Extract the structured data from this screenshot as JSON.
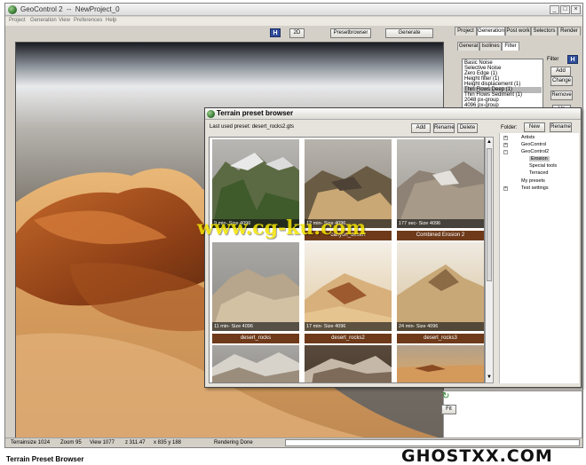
{
  "window": {
    "title": "GeoControl 2  --  NewProject_0",
    "btn_min": "_",
    "btn_max": "□",
    "btn_close": "×"
  },
  "menu": [
    "Project",
    "Generation",
    "View",
    "Preferences",
    "Help"
  ],
  "toolbar": {
    "h_button": "H",
    "view_2d": "2D",
    "preset_browser": "Presetbrowser",
    "generate": "Generate"
  },
  "right_panel": {
    "tabs": [
      "Project",
      "Generation",
      "Post work",
      "Selectors",
      "Render"
    ],
    "subtabs": [
      "General",
      "Isolines",
      "Filter"
    ],
    "filter_label": "Filter",
    "h_button": "H",
    "filters": [
      "Basic Noise",
      "Selective Noise",
      "Zero Edge  (1)",
      "Height filter  (1)",
      "Height displacement  (1)",
      "Thin Flows Deep  (1)",
      "Thin Flows Sediment  (1)",
      "2048 px-group",
      "4096 px-group"
    ],
    "selected_filter_index": 5,
    "buttons": {
      "add": "Add",
      "change": "Change",
      "remove": "Remove",
      "up": "Up"
    },
    "fit": "Fit"
  },
  "dialog": {
    "title": "Terrain preset browser",
    "last_used": "Last used preset: desert_rocks2.gts",
    "buttons": {
      "add": "Add",
      "rename": "Rename",
      "delete": "Delete"
    },
    "folder_label": "Folder:",
    "folder_buttons": {
      "new": "New",
      "rename": "Rename"
    },
    "presets": [
      {
        "caption": "9 min- Size 4096",
        "name": ""
      },
      {
        "caption": "12 min- Size 4096",
        "name": "canyon_desert"
      },
      {
        "caption": "177 sec- Size 4096",
        "name": "Combined Erosion 2"
      },
      {
        "caption": "11 min- Size 4096",
        "name": "desert_rocks"
      },
      {
        "caption": "17 min- Size 4096",
        "name": "desert_rocks2"
      },
      {
        "caption": "24 min- Size 4096",
        "name": "desert_rocks3"
      },
      {
        "caption": "",
        "name": ""
      },
      {
        "caption": "",
        "name": ""
      },
      {
        "caption": "",
        "name": ""
      }
    ],
    "folders": [
      {
        "label": "Artists",
        "expander": "+"
      },
      {
        "label": "GeoControl",
        "expander": "+"
      },
      {
        "label": "GeoControl2",
        "expander": "-"
      },
      {
        "label": "Erosion",
        "expander": ""
      },
      {
        "label": "Special tools",
        "expander": ""
      },
      {
        "label": "Terraced",
        "expander": ""
      },
      {
        "label": "My presets",
        "expander": ""
      },
      {
        "label": "Test settings",
        "expander": "+"
      }
    ]
  },
  "status": {
    "terrainsize": "Terrainsize  1024",
    "zoom": "Zoom  95",
    "view": "View  1077",
    "z": "z 311.47",
    "xy": "x 835 y 188",
    "state": "Rendering Done"
  },
  "caption": "Terrain Preset Browser",
  "watermark": "www.cg-ku.com",
  "brand": "GHOSTXX.COM",
  "colors": {
    "selection": "#b9b9b9",
    "preset_name_bar": "#6e3a1a",
    "watermark_yellow": "#f3e400",
    "h_button": "#2f4d9a"
  }
}
